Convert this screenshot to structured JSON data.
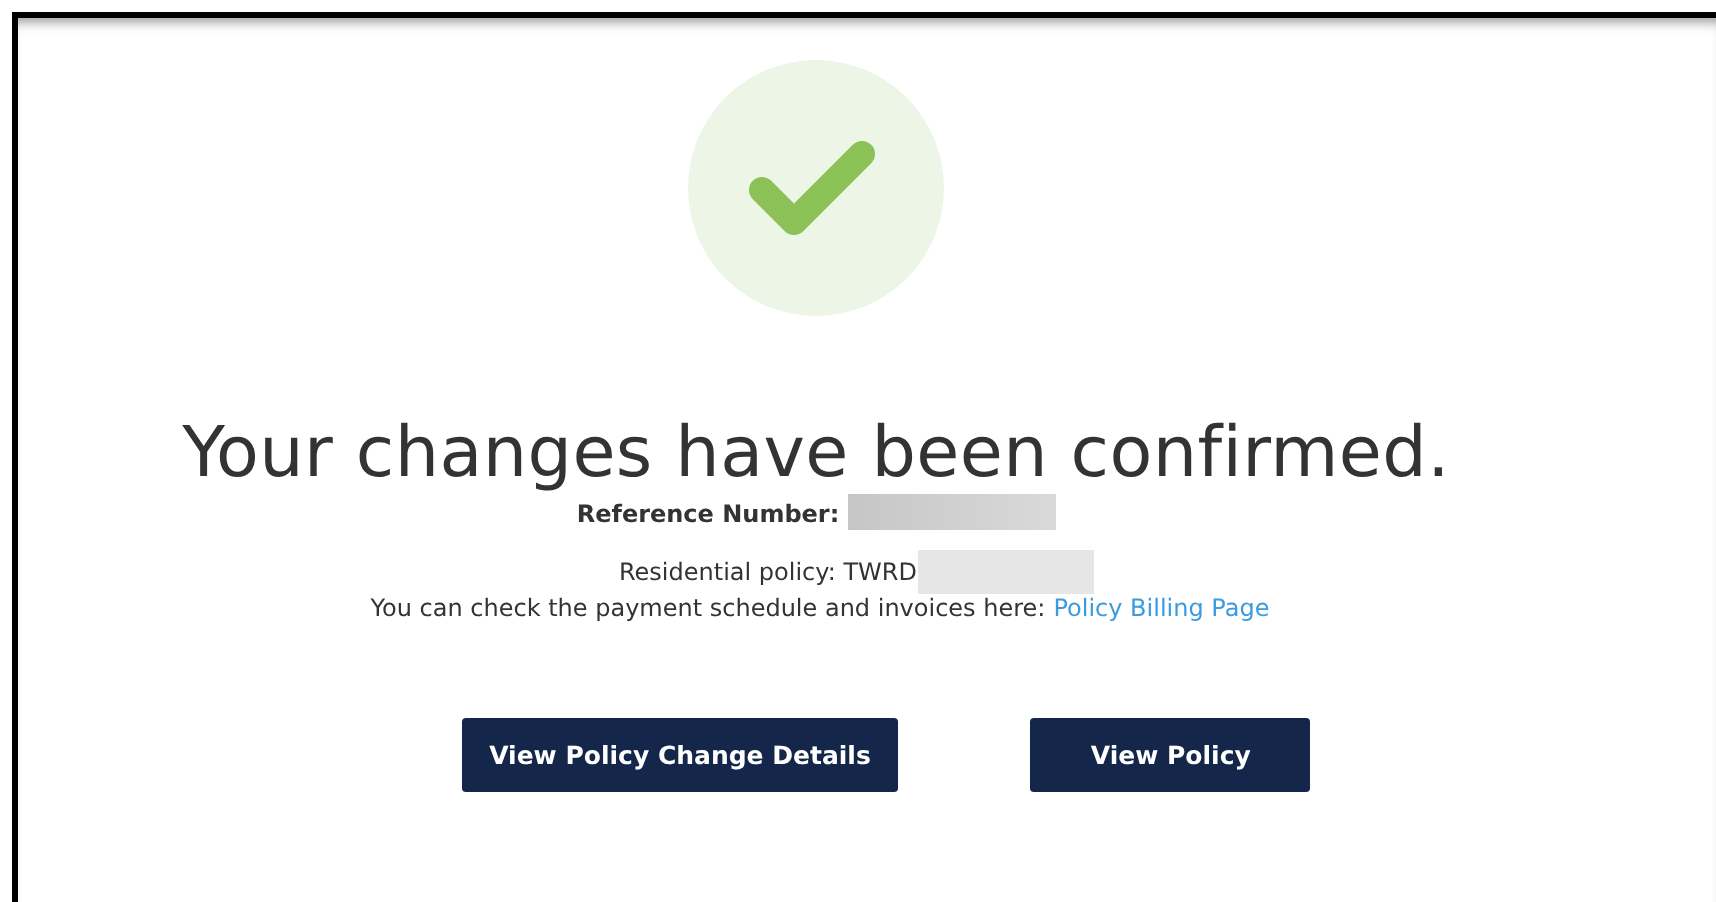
{
  "confirmation": {
    "title": "Your changes have been confirmed.",
    "reference_label": "Reference Number:",
    "policy_label": "Residential policy: TWRD",
    "billing_text": "You can check the payment schedule and invoices here:",
    "billing_link": "Policy Billing Page"
  },
  "buttons": [
    {
      "label": "View Policy Change Details"
    },
    {
      "label": "View Policy"
    }
  ]
}
